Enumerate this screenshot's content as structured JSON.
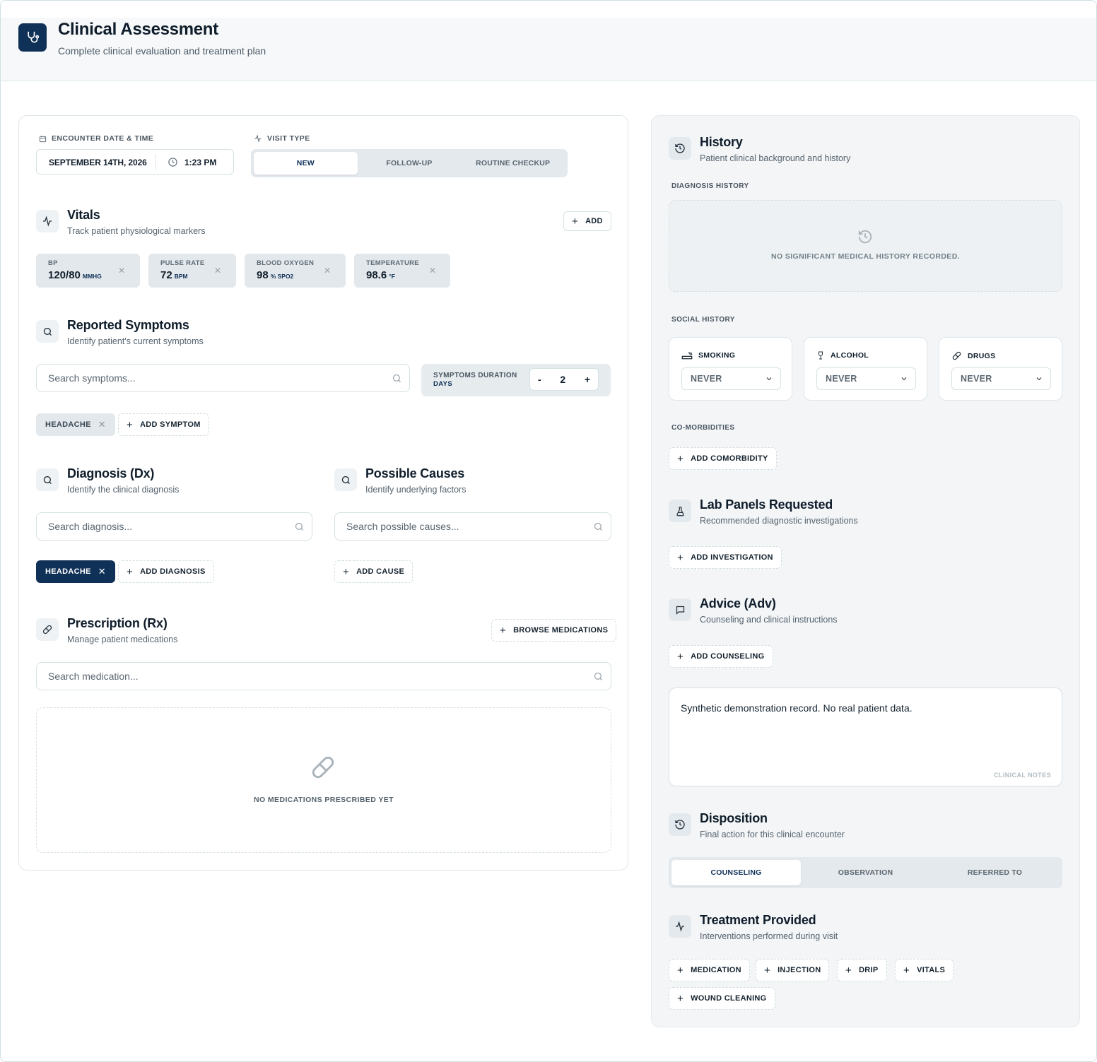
{
  "header": {
    "title": "Clinical Assessment",
    "subtitle": "Complete clinical evaluation and treatment plan"
  },
  "encounter": {
    "label": "ENCOUNTER DATE & TIME",
    "date": "SEPTEMBER 14TH, 2026",
    "time": "1:23 PM"
  },
  "visit_type": {
    "label": "VISIT TYPE",
    "options": [
      "NEW",
      "FOLLOW-UP",
      "ROUTINE CHECKUP"
    ],
    "selected": "NEW"
  },
  "vitals": {
    "title": "Vitals",
    "subtitle": "Track patient physiological markers",
    "add_label": "ADD",
    "items": [
      {
        "label": "BP",
        "value": "120/80",
        "unit": "MMHG"
      },
      {
        "label": "PULSE RATE",
        "value": "72",
        "unit": "BPM"
      },
      {
        "label": "BLOOD OXYGEN",
        "value": "98",
        "unit": "% SPO2"
      },
      {
        "label": "TEMPERATURE",
        "value": "98.6",
        "unit": "°F"
      }
    ]
  },
  "symptoms": {
    "title": "Reported Symptoms",
    "subtitle": "Identify patient's current symptoms",
    "placeholder": "Search symptoms...",
    "duration_label": "SYMPTOMS DURATION",
    "duration_unit": "DAYS",
    "duration_value": "2",
    "minus": "-",
    "plus": "+",
    "chip": "HEADACHE",
    "add_label": "ADD SYMPTOM"
  },
  "diagnosis": {
    "title": "Diagnosis (Dx)",
    "subtitle": "Identify the clinical diagnosis",
    "placeholder": "Search diagnosis...",
    "chip": "HEADACHE",
    "add_label": "ADD DIAGNOSIS"
  },
  "causes": {
    "title": "Possible Causes",
    "subtitle": "Identify underlying factors",
    "placeholder": "Search possible causes...",
    "add_label": "ADD CAUSE"
  },
  "prescription": {
    "title": "Prescription (Rx)",
    "subtitle": "Manage patient medications",
    "browse_label": "BROWSE MEDICATIONS",
    "placeholder": "Search medication...",
    "empty": "NO MEDICATIONS PRESCRIBED YET"
  },
  "history": {
    "title": "History",
    "subtitle": "Patient clinical background and history",
    "dx_label": "DIAGNOSIS HISTORY",
    "dx_empty": "NO SIGNIFICANT MEDICAL HISTORY RECORDED.",
    "social_label": "SOCIAL HISTORY",
    "social": [
      {
        "label": "SMOKING",
        "value": "NEVER"
      },
      {
        "label": "ALCOHOL",
        "value": "NEVER"
      },
      {
        "label": "DRUGS",
        "value": "NEVER"
      }
    ],
    "comorb_label": "CO-MORBIDITIES",
    "comorb_add": "ADD COMORBIDITY"
  },
  "labs": {
    "title": "Lab Panels Requested",
    "subtitle": "Recommended diagnostic investigations",
    "add_label": "ADD INVESTIGATION"
  },
  "advice": {
    "title": "Advice (Adv)",
    "subtitle": "Counseling and clinical instructions",
    "add_label": "ADD COUNSELING",
    "notes": "Synthetic demonstration record. No real patient data.",
    "notes_label": "CLINICAL NOTES"
  },
  "disposition": {
    "title": "Disposition",
    "subtitle": "Final action for this clinical encounter",
    "options": [
      "COUNSELING",
      "OBSERVATION",
      "REFERRED TO"
    ],
    "selected": "COUNSELING"
  },
  "treatment": {
    "title": "Treatment Provided",
    "subtitle": "Interventions performed during visit",
    "buttons": [
      "MEDICATION",
      "INJECTION",
      "DRIP",
      "VITALS",
      "WOUND CLEANING"
    ]
  }
}
